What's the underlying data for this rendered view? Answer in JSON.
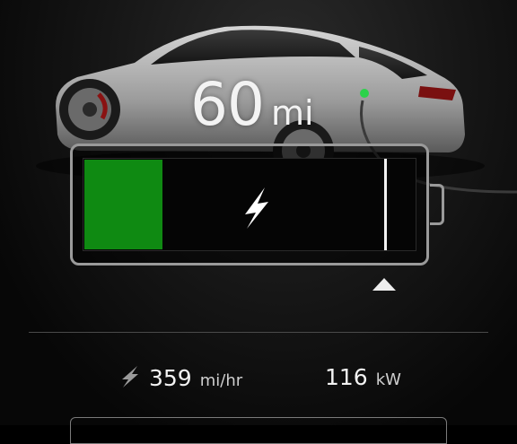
{
  "range": {
    "value": "60",
    "unit": "mi"
  },
  "battery": {
    "charge_level": 0.236,
    "charge_limit": 0.905
  },
  "stats": {
    "charge_rate": {
      "value": "359",
      "unit": "mi/hr"
    },
    "power": {
      "value": "116",
      "unit": "kW"
    }
  },
  "colors": {
    "fill": "#0f8a12",
    "charge_port_led": "#2bd24a",
    "background": "#111111"
  },
  "icons": {
    "charging": "lightning-bolt-icon",
    "limit_marker": "triangle-up-icon",
    "rate": "lightning-bolt-icon"
  }
}
